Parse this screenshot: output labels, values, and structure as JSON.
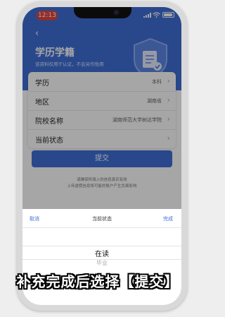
{
  "status_bar": {
    "time": "12:13"
  },
  "header": {
    "back_glyph": "‹",
    "title": "学历学籍",
    "subtitle": "该资料仅用于认证，不会另作他用",
    "illustration_icon": "shield-document-icon"
  },
  "form": {
    "rows": [
      {
        "label": "学历",
        "value": "本科"
      },
      {
        "label": "地区",
        "value": "湖南省"
      },
      {
        "label": "院校名称",
        "value": "湖南师范大学树达学院"
      },
      {
        "label": "当前状态",
        "value": ""
      }
    ]
  },
  "submit_label": "提交",
  "hints": {
    "line1": "请确保所填入的信息真实有效",
    "line2": "上传虚假信息将可能的账户产生负面影响"
  },
  "picker": {
    "cancel": "取消",
    "title": "当前状态",
    "done": "完成",
    "options": [
      "在读",
      "毕业"
    ],
    "selected": "在读"
  },
  "caption": "补充完成后选择【提交】",
  "colors": {
    "accent": "#3f6fd7",
    "status_pill": "#e0463f",
    "caption_text": "#ffffff"
  }
}
